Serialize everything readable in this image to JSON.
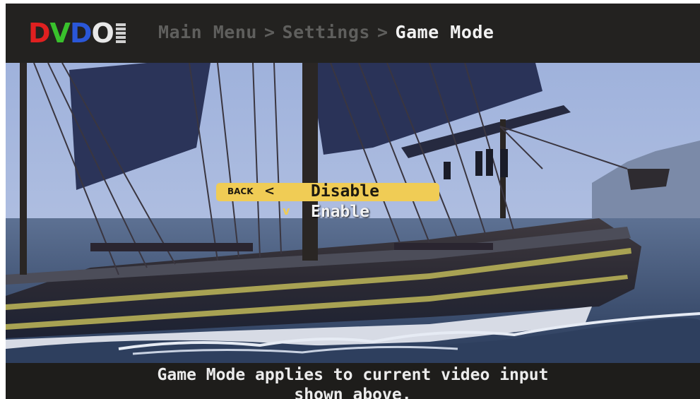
{
  "logo": {
    "letters": [
      {
        "char": "D",
        "color": "#e02020"
      },
      {
        "char": "V",
        "color": "#39c12c"
      },
      {
        "char": "D",
        "color": "#2a57d8"
      },
      {
        "char": "O",
        "color": "#e8e8e8"
      }
    ],
    "mark_icon": "dvdo-mark-icon"
  },
  "breadcrumb": {
    "items": [
      "Main Menu",
      "Settings",
      "Game Mode"
    ],
    "separator": ">"
  },
  "menu": {
    "back_label": "BACK",
    "back_icon": "chevron-left-icon",
    "options": [
      {
        "label": "Disable",
        "highlighted": true,
        "checked": false
      },
      {
        "label": "Enable",
        "highlighted": false,
        "checked": true
      }
    ],
    "check_icon": "checkmark-icon",
    "check_glyph": "v"
  },
  "info": {
    "line1": "Game Mode applies to current video input",
    "line2": "shown above."
  },
  "colors": {
    "highlight": "#f0cc55",
    "bar_bg": "#232220",
    "inactive_crumb": "#5f5f5d",
    "active_crumb": "#f2f2f2"
  }
}
